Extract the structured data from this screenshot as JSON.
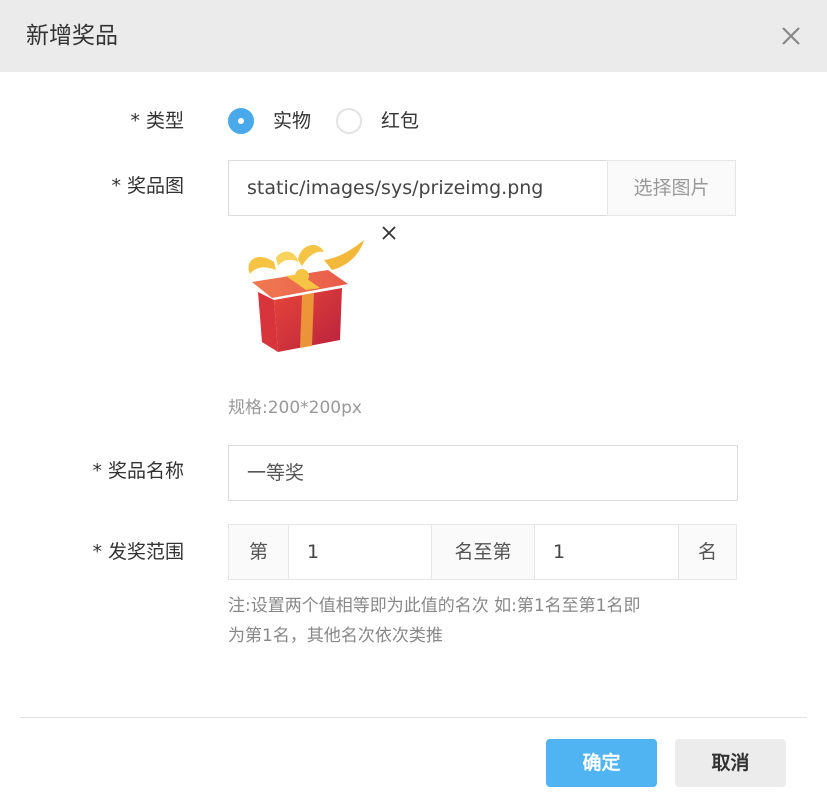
{
  "dialog": {
    "title": "新增奖品",
    "close_icon": "close-icon"
  },
  "form": {
    "type": {
      "required_mark": "*",
      "label": "类型",
      "options": [
        {
          "label": "实物",
          "selected": true
        },
        {
          "label": "红包",
          "selected": false
        }
      ]
    },
    "image": {
      "required_mark": "*",
      "label": "奖品图",
      "value": "static/images/sys/prizeimg.png",
      "select_button": "选择图片",
      "remove_icon": "close-icon",
      "preview_icon": "gift-box-icon",
      "spec": "规格:200*200px"
    },
    "name": {
      "required_mark": "*",
      "label": "奖品名称",
      "value": "一等奖"
    },
    "range": {
      "required_mark": "*",
      "label": "发奖范围",
      "prefix": "第",
      "from_value": "1",
      "middle": "名至第",
      "to_value": "1",
      "suffix": "名",
      "note_line1": "注:设置两个值相等即为此值的名次 如:第1名至第1名即",
      "note_line2": "为第1名，其他名次依次类推"
    }
  },
  "footer": {
    "ok_label": "确定",
    "cancel_label": "取消"
  },
  "colors": {
    "accent": "#4aa9ea",
    "ok_button": "#50b4f3",
    "titlebar": "#ebebeb"
  }
}
